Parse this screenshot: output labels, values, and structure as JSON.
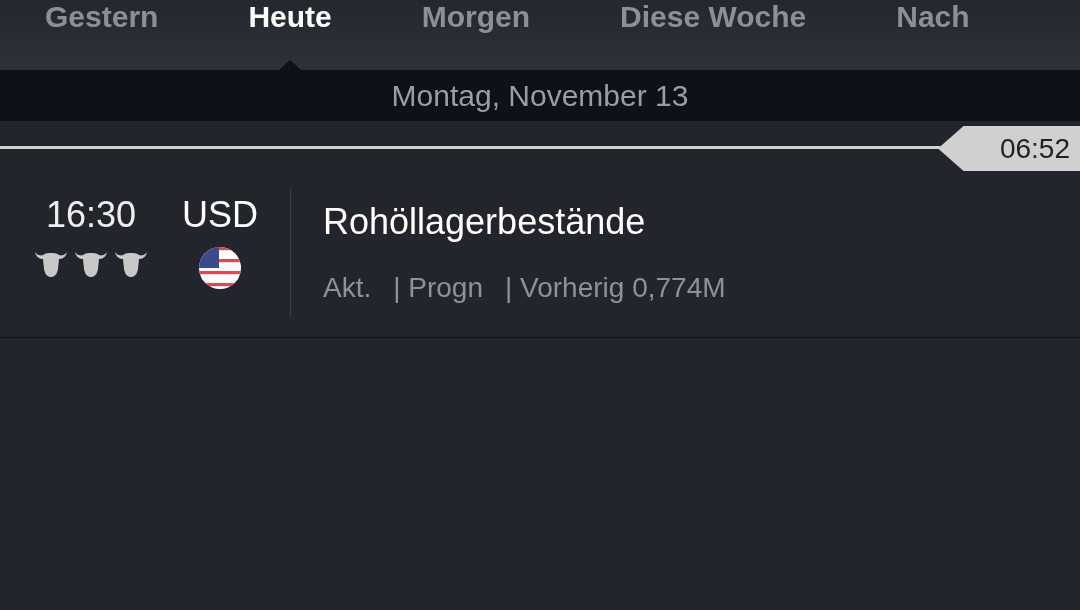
{
  "tabs": [
    {
      "label": "Gestern",
      "selected": false
    },
    {
      "label": "Heute",
      "selected": true
    },
    {
      "label": "Morgen",
      "selected": false
    },
    {
      "label": "Diese Woche",
      "selected": false
    },
    {
      "label": "Nach",
      "selected": false
    }
  ],
  "date_header": "Montag, November 13",
  "current_time": "06:52",
  "events": [
    {
      "time": "16:30",
      "currency": "USD",
      "stars": 3,
      "title": "Rohöllagerbestände",
      "stats": [
        "Akt.",
        "| Progn",
        "| Vorherig 0,774M"
      ]
    }
  ]
}
